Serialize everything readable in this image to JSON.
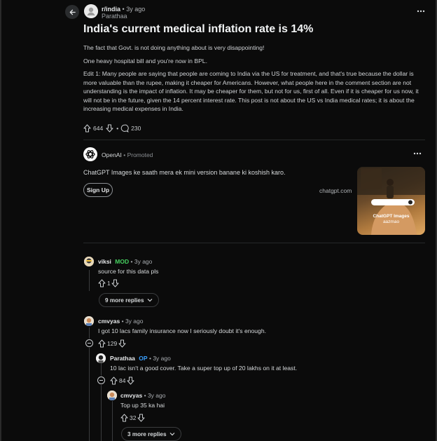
{
  "post": {
    "subreddit": "r/india",
    "age": "3y ago",
    "author": "Parathaa",
    "title": "India's current medical inflation rate is 14%",
    "paragraphs": [
      "The fact that Govt. is not doing anything about is very disappointing!",
      "One heavy hospital bill and you're now in BPL.",
      "Edit 1: Many people are saying that people are coming to India via the US for treatment, and that's true because the dollar is more valuable than the rupee, making it cheaper for Americans. However, what people here in the comment section are not understanding is the impact of inflation. It may be cheaper for them, but not for us, first of all. Even if it is cheaper for us now, it will not be in the future, given the 14 percent interest rate. This post is not about the US vs India medical rates; it is about the increasing medical expenses in India."
    ],
    "upvotes": "644",
    "comments": "230"
  },
  "ad": {
    "advertiser": "OpenAI",
    "promoted_label": "Promoted",
    "text": "ChatGPT Images ke saath mera ek mini version banane ki koshish karo.",
    "cta": "Sign Up",
    "domain": "chatgpt.com",
    "image_caption_line1": "ChatGPT Images",
    "image_caption_line2": "aazmao"
  },
  "comments": [
    {
      "user": "viksi",
      "badge": "MOD",
      "age": "3y ago",
      "text": "source for this data pls",
      "votes": "1",
      "more_replies": "9 more replies"
    },
    {
      "user": "cmvyas",
      "age": "3y ago",
      "text": "I got 10 lacs family insurance now I seriously doubt it's enough.",
      "votes": "129"
    },
    {
      "user": "Parathaa",
      "badge": "OP",
      "age": "3y ago",
      "text": "10 lac isn't a good cover. Take a super top up of 20 lakhs on it at least.",
      "votes": "84"
    },
    {
      "user": "cmvyas",
      "age": "3y ago",
      "text": "Top up 35 ka hai",
      "votes": "32",
      "more_replies": "3 more replies"
    }
  ],
  "separator": "•",
  "colors": {
    "accent_mod": "#46d160",
    "accent_op": "#3aa0ff",
    "background": "#0b0b0b"
  }
}
